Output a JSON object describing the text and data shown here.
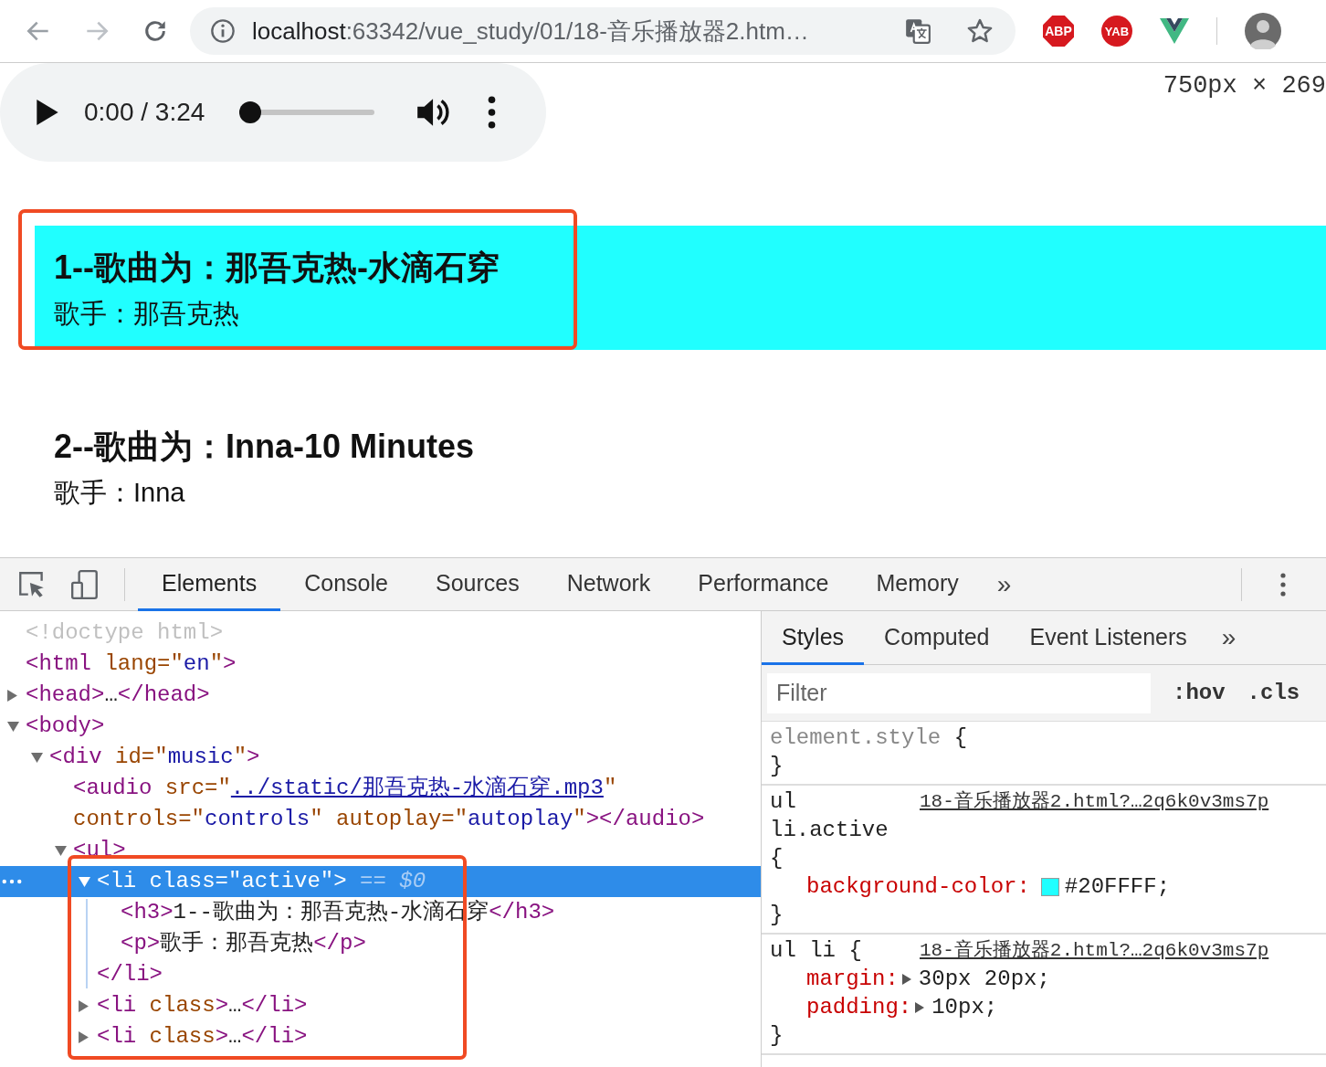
{
  "browser": {
    "url_host": "localhost",
    "url_path": ":63342/vue_study/01/18-音乐播放器2.htm…",
    "extensions": [
      {
        "kind": "abp",
        "label": "ABP"
      },
      {
        "kind": "yab",
        "label": "YAB"
      },
      {
        "kind": "vue"
      }
    ]
  },
  "page": {
    "player": {
      "time": "0:00 / 3:24",
      "level": 0
    },
    "size_tip": "750px × 269",
    "songs": [
      {
        "title": "1--歌曲为：那吾克热-水滴石穿",
        "artist": "歌手：那吾克热",
        "selected": true,
        "annotated": true
      },
      {
        "title": "2--歌曲为：Inna-10 Minutes",
        "artist": "歌手：Inna",
        "selected": false,
        "annotated": false
      }
    ]
  },
  "devtools": {
    "tabs": [
      {
        "label": "Elements",
        "selected": true
      },
      {
        "label": "Console",
        "selected": false
      },
      {
        "label": "Sources",
        "selected": false
      },
      {
        "label": "Network",
        "selected": false
      },
      {
        "label": "Performance",
        "selected": false
      },
      {
        "label": "Memory",
        "selected": false
      }
    ],
    "more": "»",
    "tree": [
      {
        "selected": false,
        "tokens": [
          {
            "kind": "doctype",
            "text": "<!doctype html>"
          }
        ]
      },
      {
        "selected": false,
        "tokens": [
          {
            "kind": "tag",
            "text": "<html "
          },
          {
            "kind": "attr",
            "text": "lang=\""
          },
          {
            "kind": "value",
            "text": "en"
          },
          {
            "kind": "attr",
            "text": "\""
          },
          {
            "kind": "tag",
            "text": ">"
          }
        ]
      },
      {
        "selected": false,
        "expanded": false,
        "tokens": [
          {
            "kind": "tag",
            "text": "<head>"
          },
          {
            "kind": "text",
            "text": "…"
          },
          {
            "kind": "tag",
            "text": "</head>"
          }
        ]
      },
      {
        "selected": false,
        "expanded": true,
        "tokens": [
          {
            "kind": "tag",
            "text": "<body>"
          }
        ],
        "children": [
          {
            "selected": false,
            "expanded": true,
            "tokens": [
              {
                "kind": "tag",
                "text": "<div "
              },
              {
                "kind": "attr",
                "text": "id=\""
              },
              {
                "kind": "value",
                "text": "music"
              },
              {
                "kind": "attr",
                "text": "\""
              },
              {
                "kind": "tag",
                "text": ">"
              }
            ],
            "children": [
              {
                "selected": false,
                "tokens": [
                  {
                    "kind": "tag",
                    "text": "<audio "
                  },
                  {
                    "kind": "attr",
                    "text": "src=\""
                  },
                  {
                    "kind": "link",
                    "text": "../static/那吾克热-水滴石穿.mp3"
                  },
                  {
                    "kind": "attr",
                    "text": "\" "
                  },
                  {
                    "kind": "attr",
                    "text": "controls=\""
                  },
                  {
                    "kind": "value",
                    "text": "controls"
                  },
                  {
                    "kind": "attr",
                    "text": "\" "
                  },
                  {
                    "kind": "attr",
                    "text": "autoplay=\""
                  },
                  {
                    "kind": "value",
                    "text": "autoplay"
                  },
                  {
                    "kind": "attr",
                    "text": "\""
                  },
                  {
                    "kind": "tag",
                    "text": "></audio>"
                  }
                ]
              },
              {
                "selected": false,
                "expanded": true,
                "annotated": true,
                "tokens": [
                  {
                    "kind": "tag",
                    "text": "<ul>"
                  }
                ],
                "children": [
                  {
                    "selected": true,
                    "expanded": true,
                    "tokens": [
                      {
                        "kind": "tag",
                        "text": "<li "
                      },
                      {
                        "kind": "attr",
                        "text": "class=\""
                      },
                      {
                        "kind": "value",
                        "text": "active"
                      },
                      {
                        "kind": "attr",
                        "text": "\""
                      },
                      {
                        "kind": "tag",
                        "text": ">"
                      },
                      {
                        "kind": "marker",
                        "text": " == $0"
                      }
                    ],
                    "children": [
                      {
                        "selected": false,
                        "tokens": [
                          {
                            "kind": "tag",
                            "text": "<h3>"
                          },
                          {
                            "kind": "text",
                            "text": "1--歌曲为：那吾克热-水滴石穿"
                          },
                          {
                            "kind": "tag",
                            "text": "</h3>"
                          }
                        ]
                      },
                      {
                        "selected": false,
                        "tokens": [
                          {
                            "kind": "tag",
                            "text": "<p>"
                          },
                          {
                            "kind": "text",
                            "text": "歌手：那吾克热"
                          },
                          {
                            "kind": "tag",
                            "text": "</p>"
                          }
                        ]
                      }
                    ],
                    "closing": [
                      {
                        "kind": "tag",
                        "text": "</li>"
                      }
                    ]
                  },
                  {
                    "selected": false,
                    "expanded": false,
                    "tokens": [
                      {
                        "kind": "tag",
                        "text": "<li "
                      },
                      {
                        "kind": "attr",
                        "text": "class"
                      },
                      {
                        "kind": "tag",
                        "text": ">"
                      },
                      {
                        "kind": "text",
                        "text": "…"
                      },
                      {
                        "kind": "tag",
                        "text": "</li>"
                      }
                    ]
                  },
                  {
                    "selected": false,
                    "expanded": false,
                    "tokens": [
                      {
                        "kind": "tag",
                        "text": "<li "
                      },
                      {
                        "kind": "attr",
                        "text": "class"
                      },
                      {
                        "kind": "tag",
                        "text": ">"
                      },
                      {
                        "kind": "text",
                        "text": "…"
                      },
                      {
                        "kind": "tag",
                        "text": "</li>"
                      }
                    ]
                  }
                ]
              }
            ]
          }
        ]
      }
    ],
    "sidebar": {
      "tabs": [
        {
          "label": "Styles",
          "selected": true
        },
        {
          "label": "Computed",
          "selected": false
        },
        {
          "label": "Event Listeners",
          "selected": false
        }
      ],
      "more": "»",
      "filter_placeholder": "Filter",
      "toggles": [
        ":hov",
        ".cls"
      ],
      "rules": [
        {
          "kind": "inline",
          "selector": "element.style",
          "open": "{",
          "close": "}"
        },
        {
          "kind": "rule",
          "selector": "ul li.active",
          "open": "{",
          "close": "}",
          "source": "18-音乐播放器2.html?…2q6k0v3ms7p",
          "declarations": [
            {
              "property": "background-color:",
              "value": "#20FFFF;",
              "color": "#20ffff",
              "expandable": false
            }
          ]
        },
        {
          "kind": "rule",
          "selector": "ul li",
          "open": "{",
          "close": "}",
          "source": "18-音乐播放器2.html?…2q6k0v3ms7p",
          "declarations": [
            {
              "property": "margin:",
              "value": "30px 20px;",
              "expandable": true
            },
            {
              "property": "padding:",
              "value": "10px;",
              "expandable": true
            }
          ]
        }
      ]
    }
  }
}
